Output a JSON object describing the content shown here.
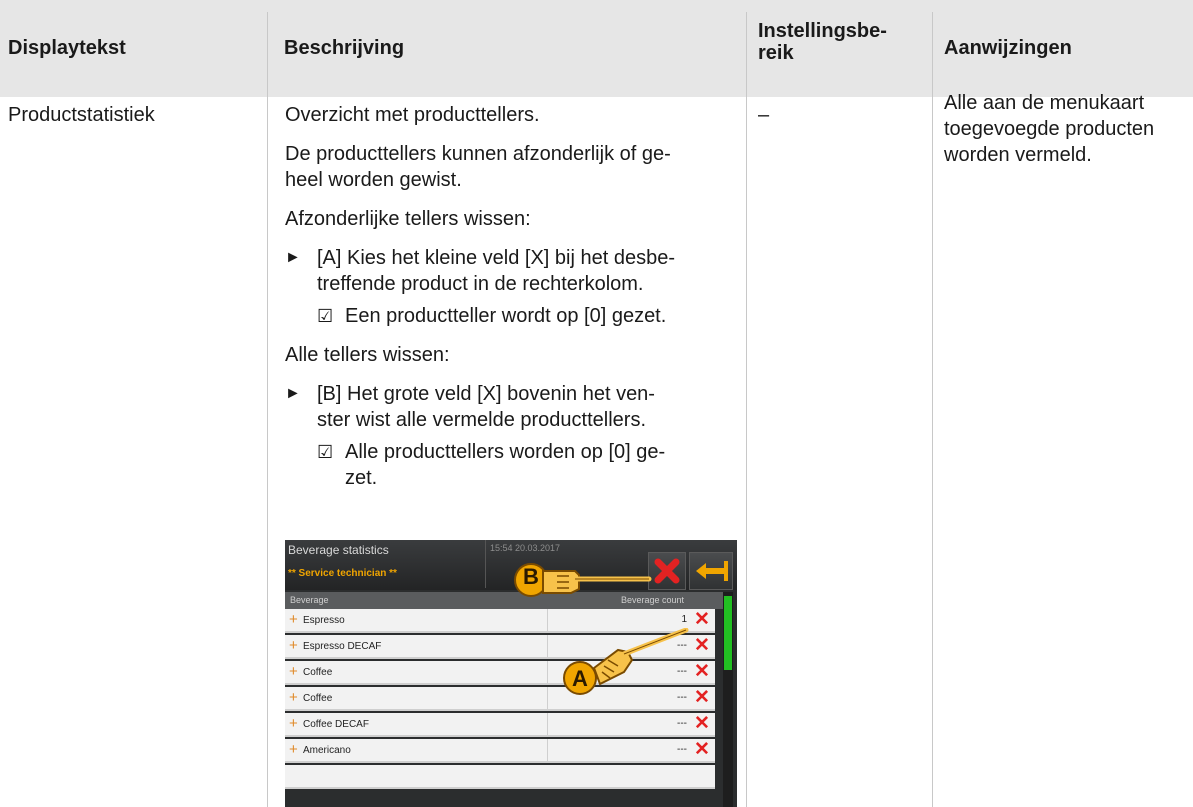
{
  "table": {
    "headers": [
      "Displaytekst",
      "Beschrijving",
      "Instellingsbe-\nreik",
      "Aanwijzingen"
    ],
    "row": {
      "display_text": "Productstatistiek",
      "description": {
        "p1": "Overzicht met producttellers.",
        "p2": "De producttellers kunnen afzonderlijk of ge-\nheel worden gewist.",
        "p3": "Afzonderlijke tellers wissen:",
        "step_a": "[A] Kies het kleine veld [X] bij het desbe-\ntreffende product in de rechterkolom.",
        "result_a": "Een productteller wordt op [0] gezet.",
        "p4": "Alle tellers wissen:",
        "step_b": "[B] Het grote veld [X] bovenin het ven-\nster wist alle vermelde producttellers.",
        "result_b": "Alle producttellers worden op [0] ge-\nzet."
      },
      "setting_range": "–",
      "notes": "Alle aan de menukaart\ntoegevoegde producten\nworden vermeld."
    },
    "markers": {
      "step": "►",
      "result": "☑"
    }
  },
  "screenshot": {
    "title": "Beverage statistics",
    "subtitle": "** Service technician **",
    "timestamp": "15:54 20.03.2017",
    "col_beverage": "Beverage",
    "col_count": "Beverage count",
    "callout_a": "A",
    "callout_b": "B",
    "rows": [
      {
        "name": "Espresso",
        "count": "1"
      },
      {
        "name": "Espresso DECAF",
        "count": "---"
      },
      {
        "name": "Coffee",
        "count": "---"
      },
      {
        "name": "Coffee",
        "count": "---"
      },
      {
        "name": "Coffee DECAF",
        "count": "---"
      },
      {
        "name": "Americano",
        "count": "---"
      }
    ]
  }
}
